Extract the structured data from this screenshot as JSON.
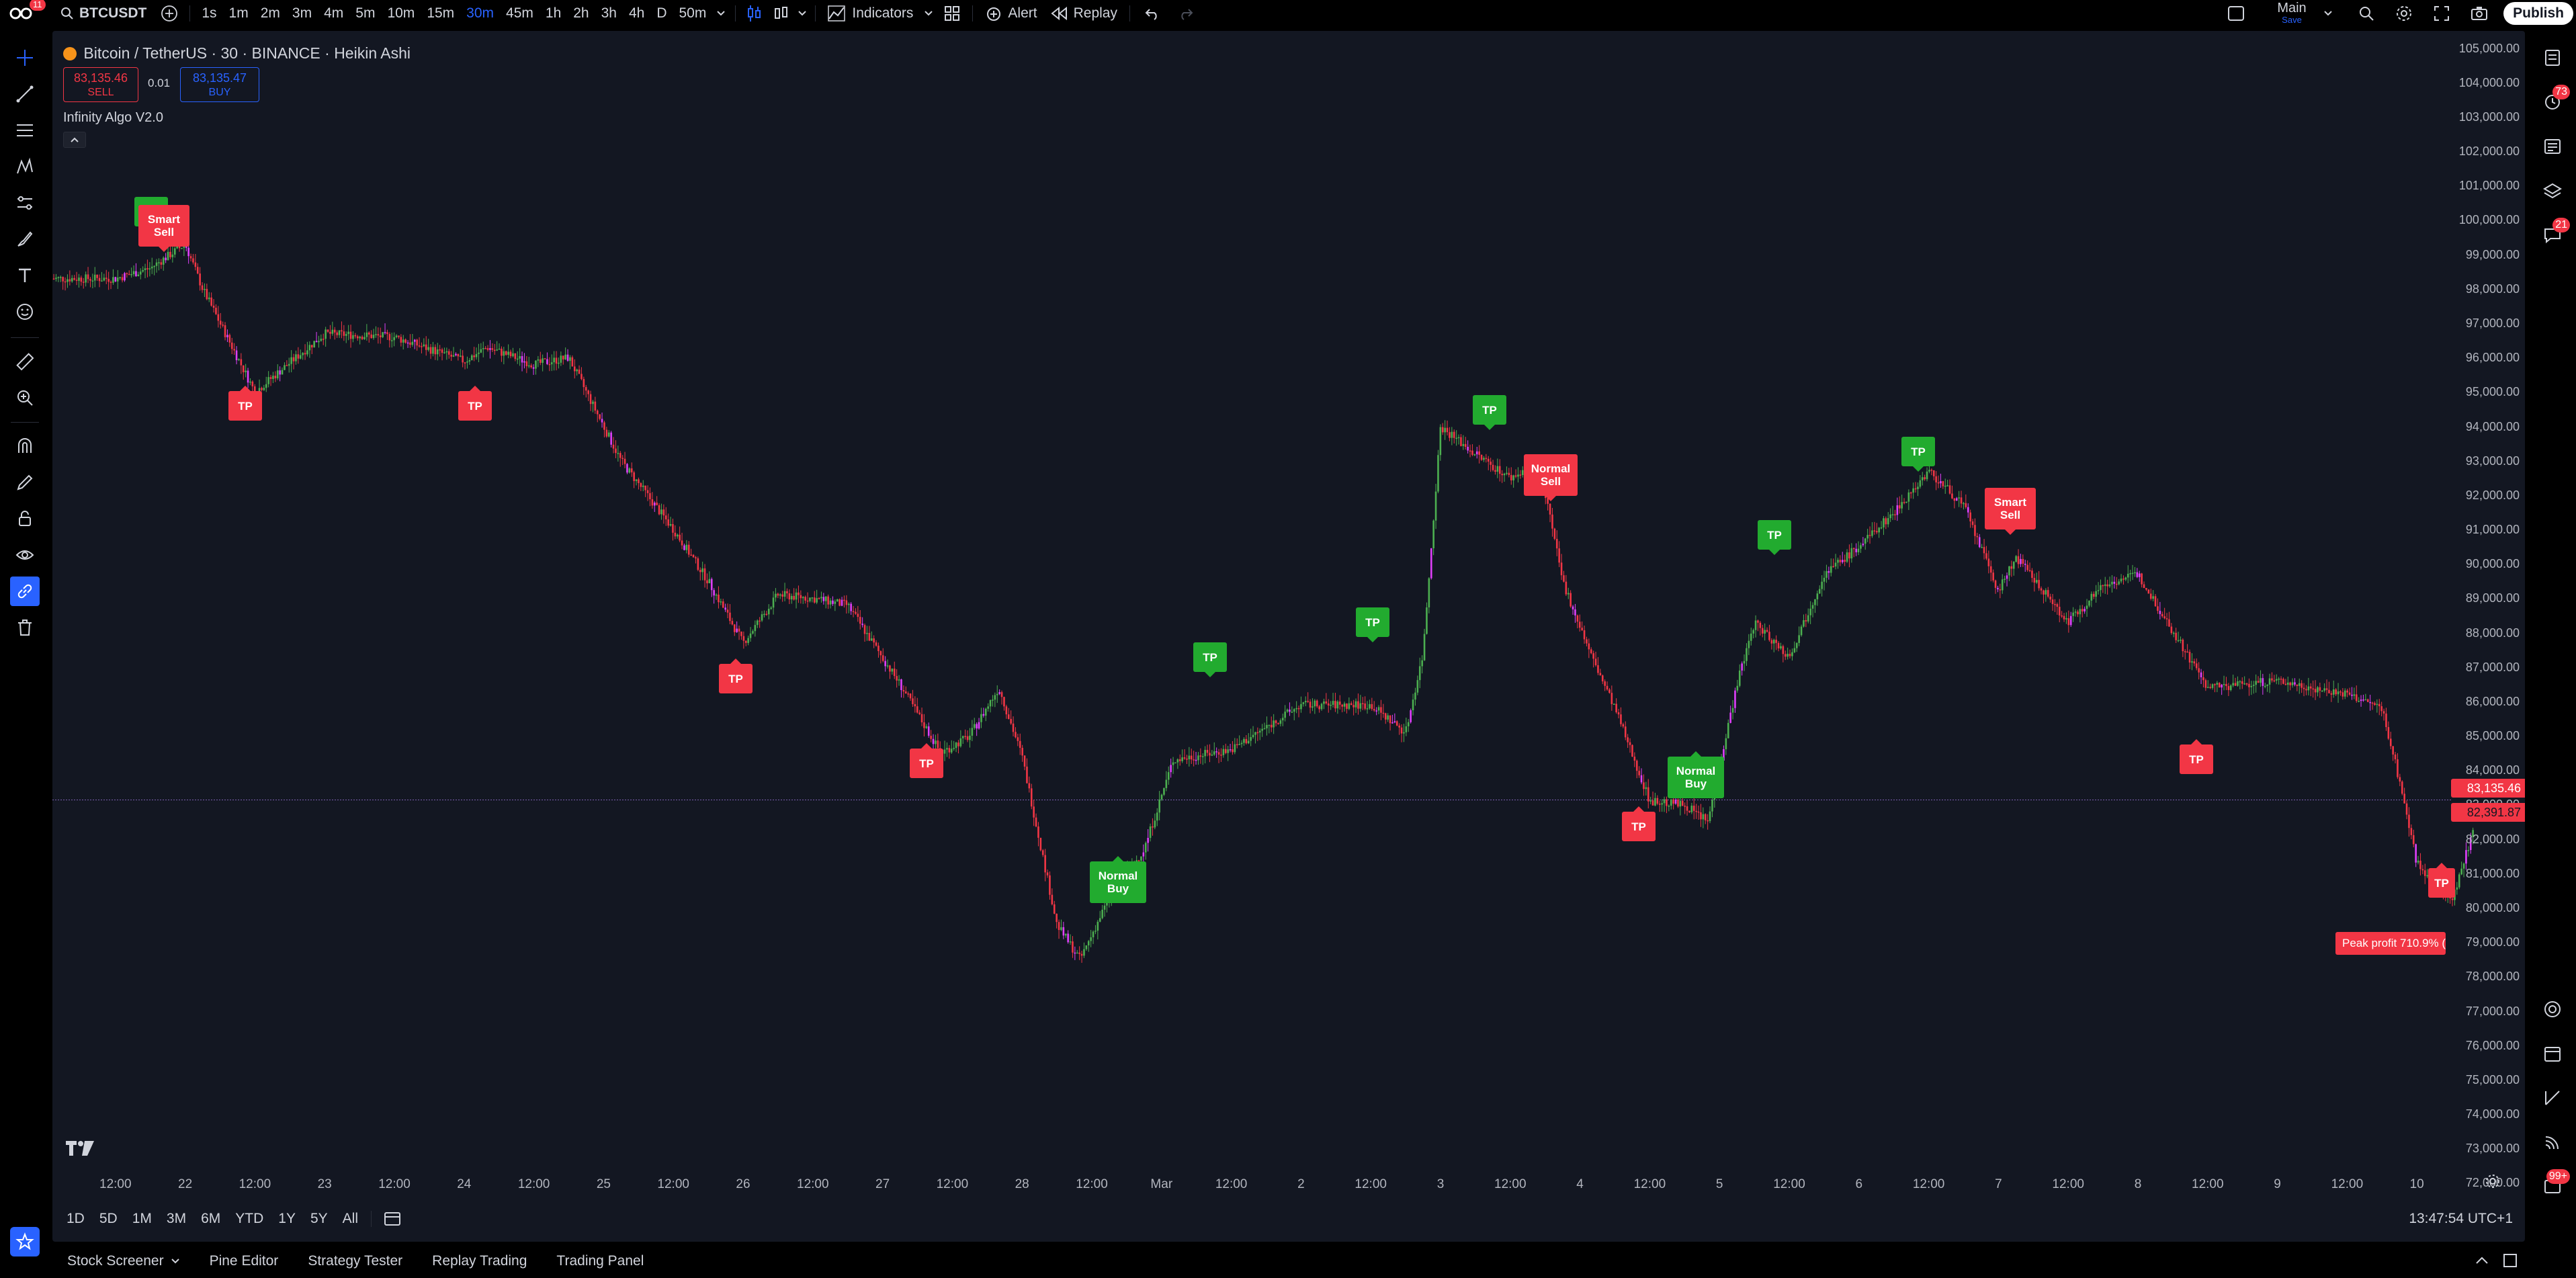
{
  "topbar": {
    "symbol": "BTCUSDT",
    "badge": "11",
    "timeframes": [
      "1s",
      "1m",
      "2m",
      "3m",
      "4m",
      "5m",
      "10m",
      "15m",
      "30m",
      "45m",
      "1h",
      "2h",
      "3h",
      "4h",
      "D",
      "50m"
    ],
    "active_timeframe": "30m",
    "indicators_label": "Indicators",
    "alert_label": "Alert",
    "replay_label": "Replay",
    "layout_name": "Main",
    "layout_sub": "Save",
    "publish_label": "Publish"
  },
  "legend": {
    "title": "Bitcoin / TetherUS · 30 · BINANCE · Heikin Ashi",
    "sell_price": "83,135.46",
    "sell_label": "SELL",
    "spread": "0.01",
    "buy_price": "83,135.47",
    "buy_label": "BUY",
    "indicator": "Infinity Algo V2.0"
  },
  "right_badges": {
    "notifications": "73",
    "chat": "21",
    "help": "99+"
  },
  "signals": [
    {
      "label": "TP",
      "color": "green"
    },
    {
      "label": "Smart Sell",
      "color": "red"
    },
    {
      "label": "TP",
      "color": "red"
    },
    {
      "label": "TP",
      "color": "red"
    },
    {
      "label": "TP",
      "color": "red"
    },
    {
      "label": "TP",
      "color": "red"
    },
    {
      "label": "Normal Buy",
      "color": "green"
    },
    {
      "label": "TP",
      "color": "green"
    },
    {
      "label": "TP",
      "color": "green"
    },
    {
      "label": "TP",
      "color": "green"
    },
    {
      "label": "Normal Sell",
      "color": "red"
    },
    {
      "label": "TP",
      "color": "red"
    },
    {
      "label": "Normal Buy",
      "color": "green"
    },
    {
      "label": "TP",
      "color": "green"
    },
    {
      "label": "TP",
      "color": "green"
    },
    {
      "label": "Smart Sell",
      "color": "red"
    },
    {
      "label": "TP",
      "color": "red"
    },
    {
      "label": "TP",
      "color": "red"
    }
  ],
  "peak_profit": "Peak profit 710.9% (",
  "price_tags": {
    "current": "83,135.46",
    "other": "82,391.87"
  },
  "chart_data": {
    "type": "line",
    "title": "Bitcoin / TetherUS · 30 · BINANCE · Heikin Ashi",
    "ylim": [
      71500,
      105500
    ],
    "y_ticks": [
      "105,000.00",
      "104,000.00",
      "103,000.00",
      "102,000.00",
      "101,000.00",
      "100,000.00",
      "99,000.00",
      "98,000.00",
      "97,000.00",
      "96,000.00",
      "95,000.00",
      "94,000.00",
      "93,000.00",
      "92,000.00",
      "91,000.00",
      "90,000.00",
      "89,000.00",
      "88,000.00",
      "87,000.00",
      "86,000.00",
      "85,000.00",
      "84,000.00",
      "83,000.00",
      "82,000.00",
      "81,000.00",
      "80,000.00",
      "79,000.00",
      "78,000.00",
      "77,000.00",
      "76,000.00",
      "75,000.00",
      "74,000.00",
      "73,000.00",
      "72,000.00"
    ],
    "x_ticks": [
      "12:00",
      "22",
      "12:00",
      "23",
      "12:00",
      "24",
      "12:00",
      "25",
      "12:00",
      "26",
      "12:00",
      "27",
      "12:00",
      "28",
      "12:00",
      "Mar",
      "12:00",
      "2",
      "12:00",
      "3",
      "12:00",
      "4",
      "12:00",
      "5",
      "12:00",
      "6",
      "12:00",
      "7",
      "12:00",
      "8",
      "12:00",
      "9",
      "12:00",
      "10"
    ],
    "x_dates": [
      "2025-02-21 12:00",
      "2025-02-22",
      "2025-02-22 12:00",
      "2025-02-23",
      "2025-02-23 12:00",
      "2025-02-24",
      "2025-02-24 12:00",
      "2025-02-25",
      "2025-02-25 12:00",
      "2025-02-26",
      "2025-02-26 12:00",
      "2025-02-27",
      "2025-02-27 12:00",
      "2025-02-28",
      "2025-02-28 12:00",
      "2025-03-01",
      "2025-03-01 12:00",
      "2025-03-02",
      "2025-03-02 12:00",
      "2025-03-03",
      "2025-03-03 12:00",
      "2025-03-04",
      "2025-03-04 12:00",
      "2025-03-05",
      "2025-03-05 12:00",
      "2025-03-06",
      "2025-03-06 12:00",
      "2025-03-07",
      "2025-03-07 12:00",
      "2025-03-08",
      "2025-03-08 12:00",
      "2025-03-09",
      "2025-03-09 12:00",
      "2025-03-10"
    ],
    "series": [
      {
        "x": [
          "2025-02-21 01:00",
          "2025-02-21 12:00",
          "2025-02-21 18:00",
          "2025-02-22 00:00",
          "2025-02-22 03:00",
          "2025-02-22 12:00",
          "2025-02-23 00:00",
          "2025-02-23 12:00",
          "2025-02-24 00:00",
          "2025-02-24 04:00",
          "2025-02-24 12:00",
          "2025-02-24 18:00",
          "2025-02-25 03:00",
          "2025-02-25 12:00",
          "2025-02-25 18:00",
          "2025-02-26 00:00",
          "2025-02-26 06:00",
          "2025-02-26 12:00",
          "2025-02-26 18:00",
          "2025-02-27 03:00",
          "2025-02-27 10:00",
          "2025-02-27 15:00",
          "2025-02-27 20:00",
          "2025-02-28 00:00",
          "2025-02-28 06:00",
          "2025-02-28 10:00",
          "2025-02-28 15:00",
          "2025-02-28 21:00",
          "2025-03-01 02:00",
          "2025-03-01 12:00",
          "2025-03-02 00:00",
          "2025-03-02 12:00",
          "2025-03-02 18:00",
          "2025-03-02 21:00",
          "2025-03-03 00:00",
          "2025-03-03 06:00",
          "2025-03-03 12:00",
          "2025-03-03 17:00",
          "2025-03-03 21:00",
          "2025-03-04 02:00",
          "2025-03-04 06:00",
          "2025-03-04 12:00",
          "2025-03-04 18:00",
          "2025-03-04 22:00",
          "2025-03-05 03:00",
          "2025-03-05 06:00",
          "2025-03-05 12:00",
          "2025-03-05 18:00",
          "2025-03-06 00:00",
          "2025-03-06 06:00",
          "2025-03-06 12:00",
          "2025-03-06 18:00",
          "2025-03-07 00:00",
          "2025-03-07 03:00",
          "2025-03-07 12:00",
          "2025-03-07 18:00",
          "2025-03-08 00:00",
          "2025-03-08 12:00",
          "2025-03-09 00:00",
          "2025-03-09 12:00",
          "2025-03-09 18:00",
          "2025-03-09 21:00",
          "2025-03-10 00:00",
          "2025-03-10 06:00",
          "2025-03-10 10:00"
        ],
        "y": [
          98300,
          98300,
          98600,
          99300,
          98000,
          95000,
          96700,
          96600,
          95900,
          96300,
          95800,
          96000,
          93000,
          91000,
          89500,
          87700,
          89100,
          89000,
          88800,
          86500,
          84500,
          85000,
          86400,
          84400,
          79500,
          78500,
          80300,
          81700,
          84300,
          84600,
          85900,
          85900,
          85100,
          87400,
          94000,
          93200,
          92500,
          92900,
          89500,
          87300,
          85800,
          83100,
          83000,
          82500,
          86500,
          88300,
          87300,
          89700,
          90500,
          91500,
          92700,
          91700,
          89200,
          90200,
          88300,
          89400,
          89700,
          86400,
          86600,
          86200,
          85800,
          83700,
          81300,
          80200,
          82400
        ]
      }
    ]
  },
  "range_buttons": [
    "1D",
    "5D",
    "1M",
    "3M",
    "6M",
    "YTD",
    "1Y",
    "5Y",
    "All"
  ],
  "clock": "13:47:54 UTC+1",
  "bottom_tabs": [
    "Stock Screener",
    "Pine Editor",
    "Strategy Tester",
    "Replay Trading",
    "Trading Panel"
  ],
  "colors": {
    "bg": "#131722",
    "up": "#4caf50",
    "down": "#f23645",
    "accent": "#2962ff",
    "tp_green": "#22ab2f",
    "magenta": "#e040fb"
  }
}
